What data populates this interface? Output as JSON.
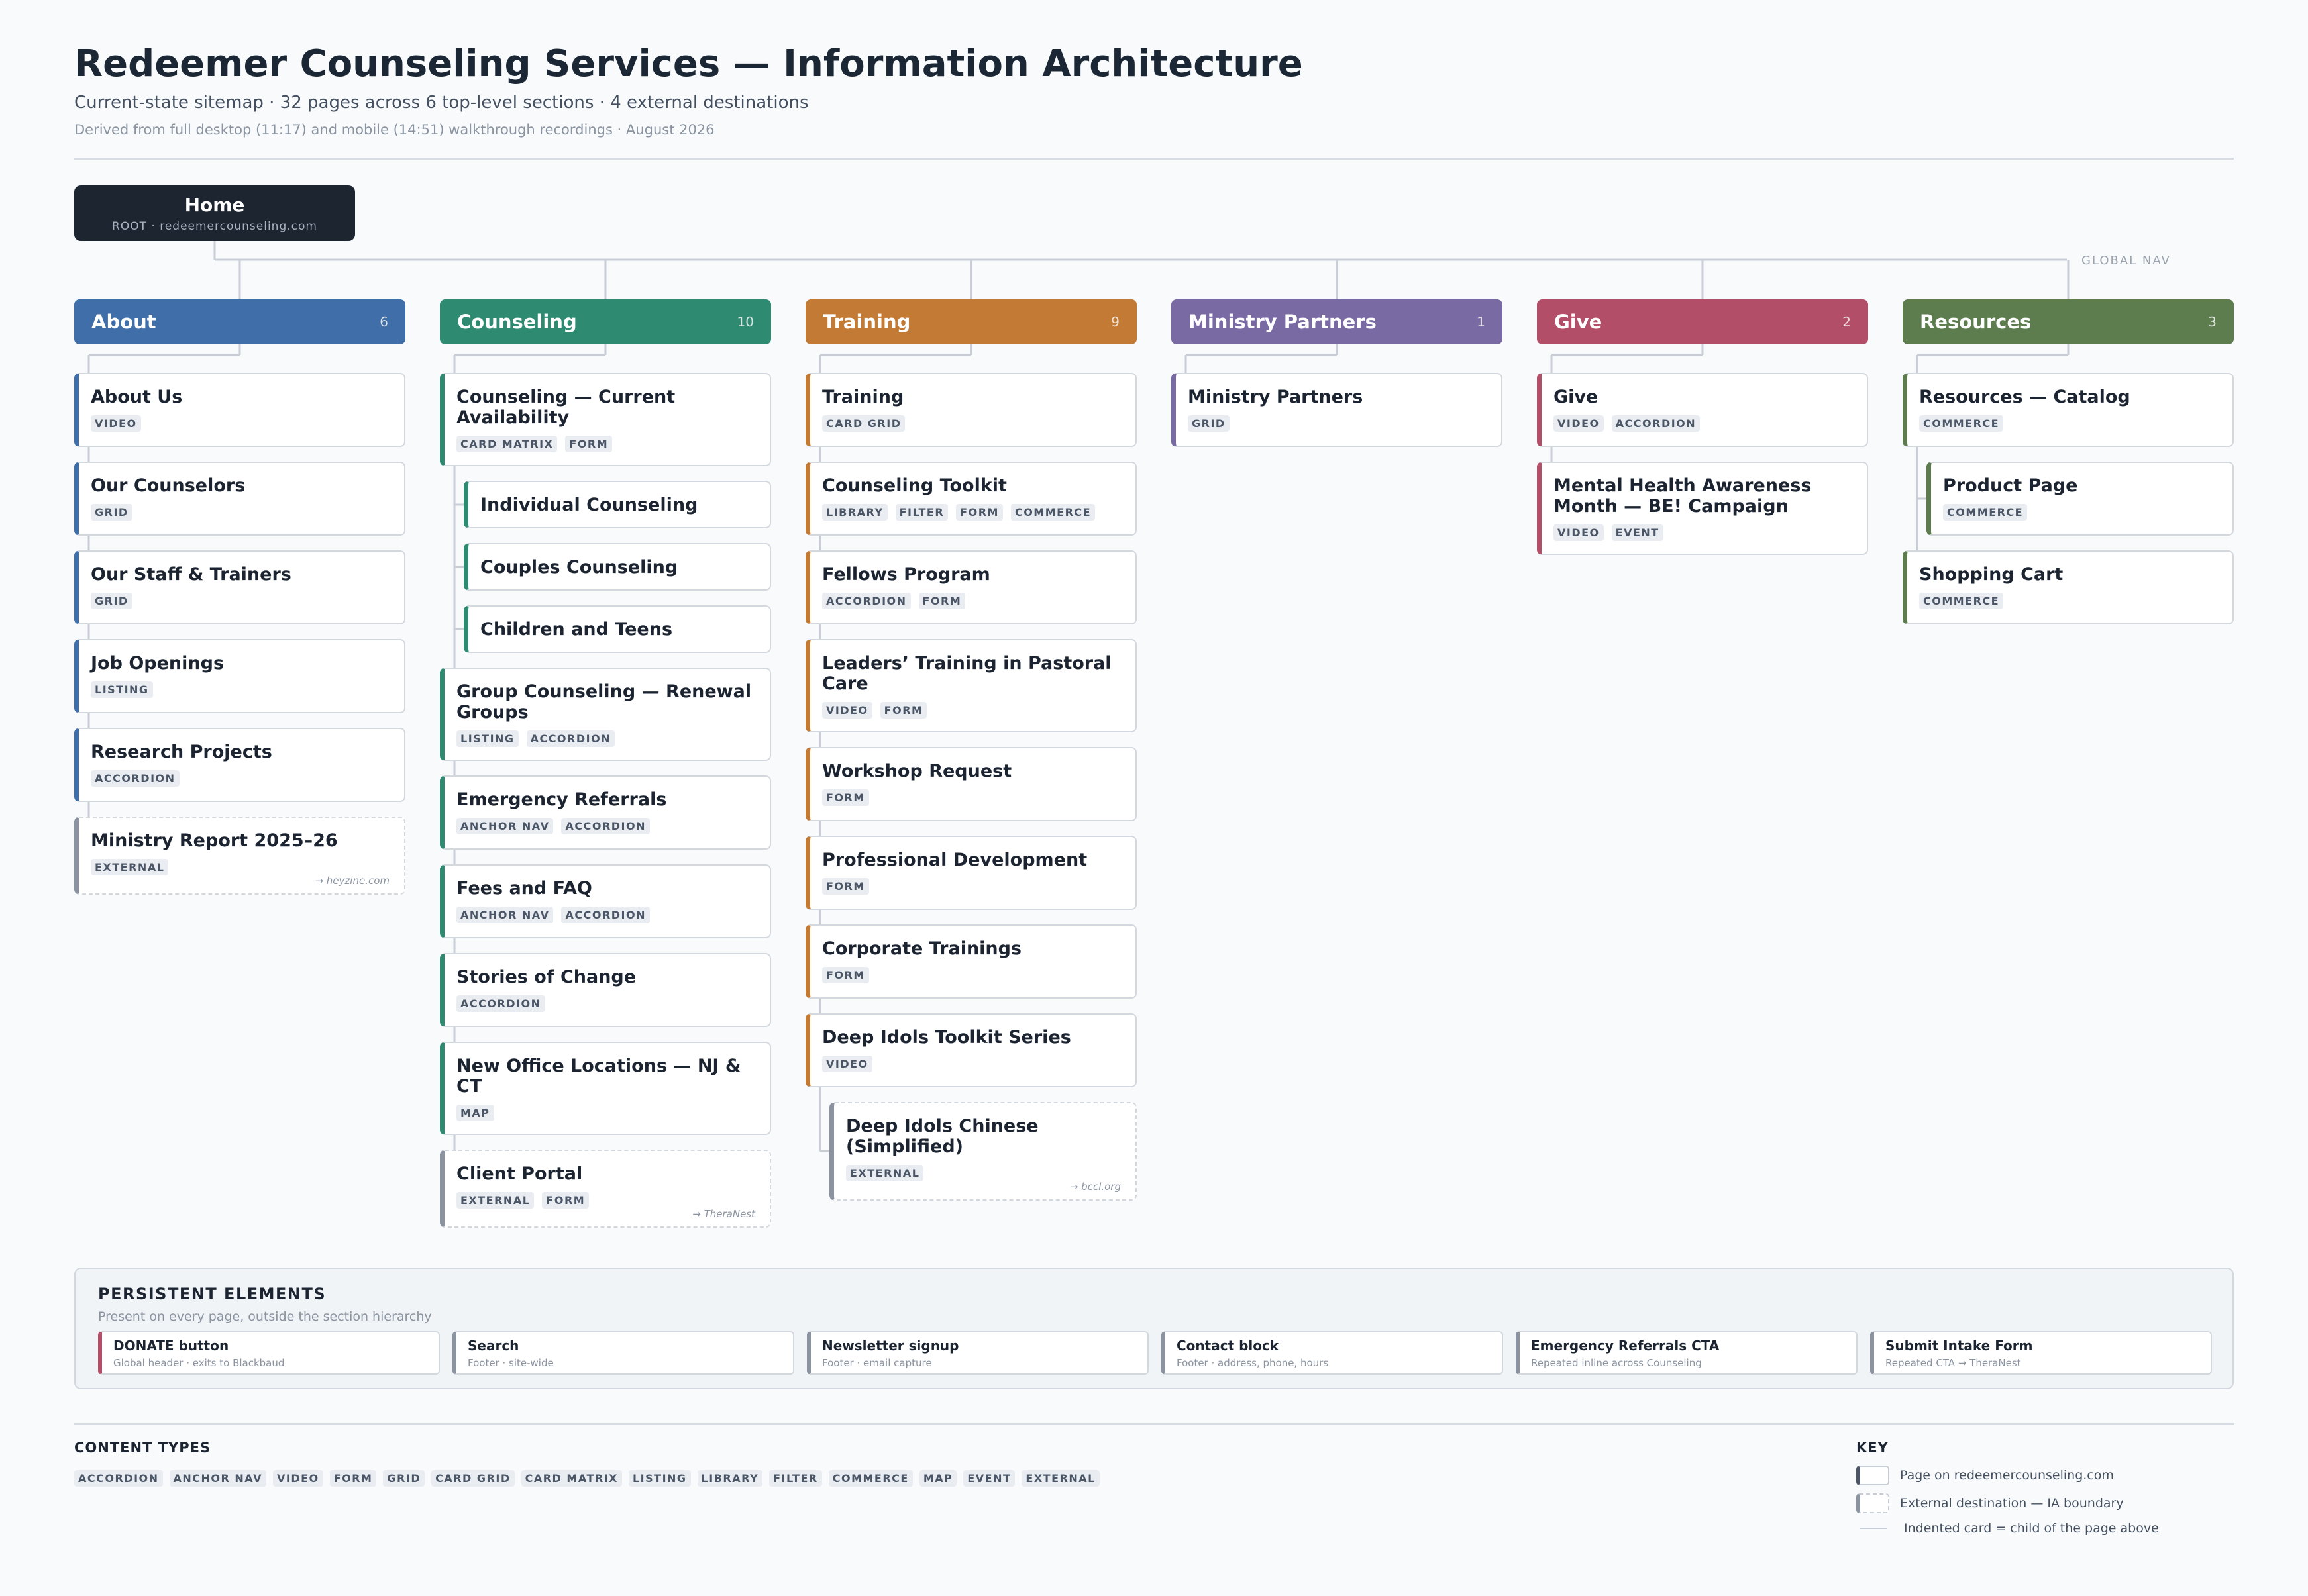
{
  "header": {
    "title": "Redeemer Counseling Services — Information Architecture",
    "subtitle": "Current-state sitemap · 32 pages across 6 top-level sections · 4 external destinations",
    "source": "Derived from full desktop (11:17) and mobile (14:51) walkthrough recordings · August 2026"
  },
  "root": {
    "label": "Home",
    "sub": "ROOT · redeemercounseling.com"
  },
  "global_nav_label": "GLOBAL NAV",
  "sections": [
    {
      "name": "About",
      "count": "6",
      "color": "#3f6ea8",
      "pages": [
        {
          "title": "About Us",
          "tags": [
            "VIDEO"
          ]
        },
        {
          "title": "Our Counselors",
          "tags": [
            "GRID"
          ]
        },
        {
          "title": "Our Staff & Trainers",
          "tags": [
            "GRID"
          ]
        },
        {
          "title": "Job Openings",
          "tags": [
            "LISTING"
          ]
        },
        {
          "title": "Research Projects",
          "tags": [
            "ACCORDION"
          ]
        },
        {
          "title": "Ministry Report 2025–26",
          "tags": [
            "EXTERNAL"
          ],
          "external": true,
          "dest": "→ heyzine.com"
        }
      ]
    },
    {
      "name": "Counseling",
      "count": "10",
      "color": "#2f8a72",
      "pages": [
        {
          "title": "Counseling — Current Availability",
          "tags": [
            "CARD MATRIX",
            "FORM"
          ]
        },
        {
          "title": "Individual Counseling",
          "tags": [],
          "child": true
        },
        {
          "title": "Couples Counseling",
          "tags": [],
          "child": true
        },
        {
          "title": "Children and Teens",
          "tags": [],
          "child": true
        },
        {
          "title": "Group Counseling — Renewal Groups",
          "tags": [
            "LISTING",
            "ACCORDION"
          ]
        },
        {
          "title": "Emergency Referrals",
          "tags": [
            "ANCHOR NAV",
            "ACCORDION"
          ]
        },
        {
          "title": "Fees and FAQ",
          "tags": [
            "ANCHOR NAV",
            "ACCORDION"
          ]
        },
        {
          "title": "Stories of Change",
          "tags": [
            "ACCORDION"
          ]
        },
        {
          "title": "New Office Locations — NJ & CT",
          "tags": [
            "MAP"
          ]
        },
        {
          "title": "Client Portal",
          "tags": [
            "EXTERNAL",
            "FORM"
          ],
          "external": true,
          "dest": "→ TheraNest"
        }
      ]
    },
    {
      "name": "Training",
      "count": "9",
      "color": "#c27a35",
      "pages": [
        {
          "title": "Training",
          "tags": [
            "CARD GRID"
          ]
        },
        {
          "title": "Counseling Toolkit",
          "tags": [
            "LIBRARY",
            "FILTER",
            "FORM",
            "COMMERCE"
          ]
        },
        {
          "title": "Fellows Program",
          "tags": [
            "ACCORDION",
            "FORM"
          ]
        },
        {
          "title": "Leaders’ Training in Pastoral Care",
          "tags": [
            "VIDEO",
            "FORM"
          ]
        },
        {
          "title": "Workshop Request",
          "tags": [
            "FORM"
          ]
        },
        {
          "title": "Professional Development",
          "tags": [
            "FORM"
          ]
        },
        {
          "title": "Corporate Trainings",
          "tags": [
            "FORM"
          ]
        },
        {
          "title": "Deep Idols Toolkit Series",
          "tags": [
            "VIDEO"
          ]
        },
        {
          "title": "Deep Idols Chinese (Simplified)",
          "tags": [
            "EXTERNAL"
          ],
          "external": true,
          "child": true,
          "dest": "→ bccl.org"
        }
      ]
    },
    {
      "name": "Ministry Partners",
      "count": "1",
      "color": "#7a6aa3",
      "pages": [
        {
          "title": "Ministry Partners",
          "tags": [
            "GRID"
          ]
        }
      ]
    },
    {
      "name": "Give",
      "count": "2",
      "color": "#b24e68",
      "pages": [
        {
          "title": "Give",
          "tags": [
            "VIDEO",
            "ACCORDION"
          ]
        },
        {
          "title": "Mental Health Awareness Month — BE! Campaign",
          "tags": [
            "VIDEO",
            "EVENT"
          ]
        }
      ]
    },
    {
      "name": "Resources",
      "count": "3",
      "color": "#5e7d4e",
      "pages": [
        {
          "title": "Resources — Catalog",
          "tags": [
            "COMMERCE"
          ]
        },
        {
          "title": "Product Page",
          "tags": [
            "COMMERCE"
          ],
          "child": true
        },
        {
          "title": "Shopping Cart",
          "tags": [
            "COMMERCE"
          ]
        }
      ]
    }
  ],
  "persistent": {
    "title": "PERSISTENT ELEMENTS",
    "subtitle": "Present on every page, outside the section hierarchy",
    "items": [
      {
        "title": "DONATE button",
        "sub": "Global header · exits to Blackbaud",
        "accent": "#b24e68"
      },
      {
        "title": "Search",
        "sub": "Footer · site-wide",
        "accent": "#8b93a1"
      },
      {
        "title": "Newsletter signup",
        "sub": "Footer · email capture",
        "accent": "#8b93a1"
      },
      {
        "title": "Contact block",
        "sub": "Footer · address, phone, hours",
        "accent": "#8b93a1"
      },
      {
        "title": "Emergency Referrals CTA",
        "sub": "Repeated inline across Counseling",
        "accent": "#8b93a1"
      },
      {
        "title": "Submit Intake Form",
        "sub": "Repeated CTA → TheraNest",
        "accent": "#8b93a1"
      }
    ]
  },
  "content_types": {
    "title": "CONTENT TYPES",
    "items": [
      "ACCORDION",
      "ANCHOR NAV",
      "VIDEO",
      "FORM",
      "GRID",
      "CARD GRID",
      "CARD MATRIX",
      "LISTING",
      "LIBRARY",
      "FILTER",
      "COMMERCE",
      "MAP",
      "EVENT",
      "EXTERNAL"
    ]
  },
  "key": {
    "title": "KEY",
    "page": "Page on redeemercounseling.com",
    "external": "External destination — IA boundary",
    "child": "Indented card = child of the page above"
  },
  "colors": {
    "root": "#1d2531",
    "connector": "#c9ced6",
    "external_accent": "#8b93a1"
  }
}
